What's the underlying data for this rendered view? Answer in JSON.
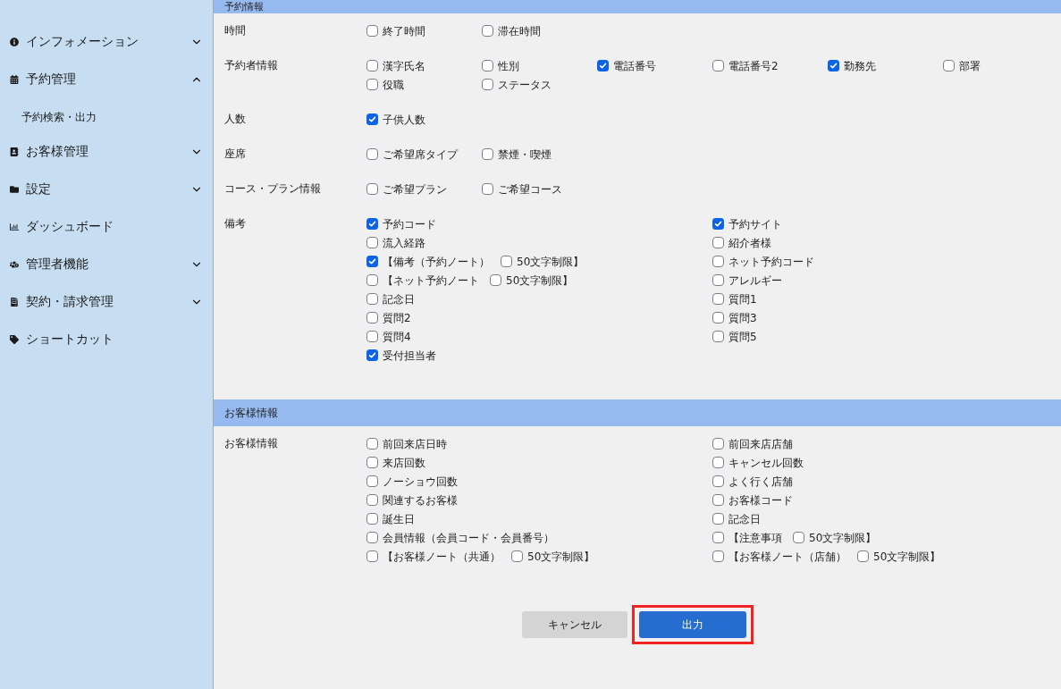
{
  "sidebar": {
    "items": [
      {
        "kind": "group",
        "label": "インフォメーション",
        "expanded": false
      },
      {
        "kind": "group",
        "label": "予約管理",
        "expanded": true,
        "children": [
          {
            "label": "予約検索・出力"
          }
        ]
      },
      {
        "kind": "group",
        "label": "お客様管理",
        "expanded": false
      },
      {
        "kind": "group",
        "label": "設定",
        "expanded": false
      },
      {
        "kind": "link",
        "label": "ダッシュボード"
      },
      {
        "kind": "group",
        "label": "管理者機能",
        "expanded": false
      },
      {
        "kind": "group",
        "label": "契約・請求管理",
        "expanded": false
      },
      {
        "kind": "link",
        "label": "ショートカット"
      }
    ]
  },
  "sections": [
    {
      "title": "予約情報",
      "rows": [
        {
          "label": "時間",
          "kind": "compact",
          "options": [
            {
              "kind": "plain",
              "label": "終了時間",
              "checked": false
            },
            {
              "kind": "plain",
              "label": "滞在時間",
              "checked": false
            }
          ]
        },
        {
          "label": "予約者情報",
          "kind": "compact",
          "options": [
            {
              "kind": "plain",
              "label": "漢字氏名",
              "checked": false
            },
            {
              "kind": "plain",
              "label": "性別",
              "checked": false
            },
            {
              "kind": "plain",
              "label": "電話番号",
              "checked": true
            },
            {
              "kind": "plain",
              "label": "電話番号2",
              "checked": false
            },
            {
              "kind": "plain",
              "label": "勤務先",
              "checked": true
            },
            {
              "kind": "plain",
              "label": "部署",
              "checked": false
            },
            {
              "kind": "plain",
              "label": "役職",
              "checked": false
            },
            {
              "kind": "plain",
              "label": "ステータス",
              "checked": false
            }
          ]
        },
        {
          "label": "人数",
          "kind": "compact",
          "options": [
            {
              "kind": "plain",
              "label": "子供人数",
              "checked": true
            }
          ]
        },
        {
          "label": "座席",
          "kind": "compact",
          "options": [
            {
              "kind": "plain",
              "label": "ご希望席タイプ",
              "checked": false
            },
            {
              "kind": "plain",
              "label": "禁煙・喫煙",
              "checked": false
            }
          ]
        },
        {
          "label": "コース・プラン情報",
          "kind": "compact",
          "options": [
            {
              "kind": "plain",
              "label": "ご希望プラン",
              "checked": false
            },
            {
              "kind": "plain",
              "label": "ご希望コース",
              "checked": false
            }
          ]
        },
        {
          "label": "備考",
          "kind": "wide",
          "options": [
            {
              "kind": "plain",
              "label": "予約コード",
              "checked": true
            },
            {
              "kind": "plain",
              "label": "予約サイト",
              "checked": true
            },
            {
              "kind": "plain",
              "label": "流入経路",
              "checked": false
            },
            {
              "kind": "plain",
              "label": "紹介者様",
              "checked": false
            },
            {
              "kind": "limited",
              "label": "【備考（予約ノート）",
              "checked": true,
              "limit": {
                "label": "50文字制限】",
                "checked": false
              }
            },
            {
              "kind": "plain",
              "label": "ネット予約コード",
              "checked": false
            },
            {
              "kind": "limited",
              "label": "【ネット予約ノート",
              "checked": false,
              "limit": {
                "label": "50文字制限】",
                "checked": false
              }
            },
            {
              "kind": "plain",
              "label": "アレルギー",
              "checked": false
            },
            {
              "kind": "plain",
              "label": "記念日",
              "checked": false
            },
            {
              "kind": "plain",
              "label": "質問1",
              "checked": false
            },
            {
              "kind": "plain",
              "label": "質問2",
              "checked": false
            },
            {
              "kind": "plain",
              "label": "質問3",
              "checked": false
            },
            {
              "kind": "plain",
              "label": "質問4",
              "checked": false
            },
            {
              "kind": "plain",
              "label": "質問5",
              "checked": false
            },
            {
              "kind": "plain",
              "label": "受付担当者",
              "checked": true
            }
          ]
        }
      ]
    },
    {
      "title": "お客様情報",
      "rows": [
        {
          "label": "お客様情報",
          "kind": "wide",
          "options": [
            {
              "kind": "plain",
              "label": "前回来店日時",
              "checked": false
            },
            {
              "kind": "plain",
              "label": "前回来店店舗",
              "checked": false
            },
            {
              "kind": "plain",
              "label": "来店回数",
              "checked": false
            },
            {
              "kind": "plain",
              "label": "キャンセル回数",
              "checked": false
            },
            {
              "kind": "plain",
              "label": "ノーショウ回数",
              "checked": false
            },
            {
              "kind": "plain",
              "label": "よく行く店舗",
              "checked": false
            },
            {
              "kind": "plain",
              "label": "関連するお客様",
              "checked": false
            },
            {
              "kind": "plain",
              "label": "お客様コード",
              "checked": false
            },
            {
              "kind": "plain",
              "label": "誕生日",
              "checked": false
            },
            {
              "kind": "plain",
              "label": "記念日",
              "checked": false
            },
            {
              "kind": "plain",
              "label": "会員情報（会員コード・会員番号）",
              "checked": false
            },
            {
              "kind": "limited",
              "label": "【注意事項",
              "checked": false,
              "limit": {
                "label": "50文字制限】",
                "checked": false
              }
            },
            {
              "kind": "limited",
              "label": "【お客様ノート（共通）",
              "checked": false,
              "limit": {
                "label": "50文字制限】",
                "checked": false
              }
            },
            {
              "kind": "limited",
              "label": "【お客様ノート（店舗）",
              "checked": false,
              "limit": {
                "label": "50文字制限】",
                "checked": false
              }
            }
          ]
        }
      ]
    }
  ],
  "buttons": [
    {
      "kind": "secondary",
      "label": "キャンセル",
      "highlighted": false
    },
    {
      "kind": "primary",
      "label": "出力",
      "highlighted": true
    }
  ]
}
